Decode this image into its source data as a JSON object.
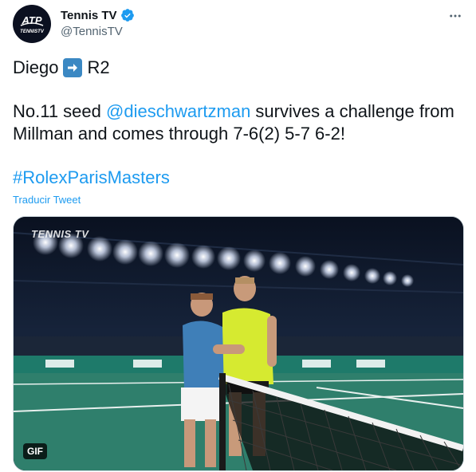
{
  "author": {
    "display_name": "Tennis TV",
    "handle": "@TennisTV",
    "verified_icon": "verified-badge-icon",
    "avatar_icon": "atp-tennis-tv-logo"
  },
  "menu": {
    "more_icon": "more-horizontal-icon"
  },
  "tweet": {
    "line1_before": "Diego",
    "line1_emoji": "right-arrow-emoji",
    "line1_after": "R2",
    "body_prefix": "No.11 seed ",
    "mention": "@dieschwartzman",
    "body_suffix": " survives a challenge from Millman and comes through 7-6(2) 5-7 6-2!",
    "hashtag": "#RolexParisMasters",
    "translate_label": "Traducir Tweet"
  },
  "media": {
    "watermark": "TENNIS TV",
    "badge": "GIF"
  },
  "colors": {
    "link": "#1d9bf0",
    "verified": "#1d9bf0",
    "emoji_bg": "#3b88c3"
  }
}
